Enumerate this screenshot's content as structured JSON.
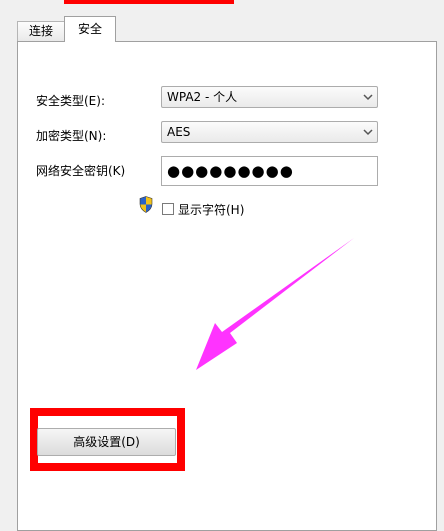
{
  "tabs": [
    {
      "label": "连接",
      "active": false
    },
    {
      "label": "安全",
      "active": true
    }
  ],
  "security_type": {
    "label": "安全类型(E):",
    "value": "WPA2 - 个人"
  },
  "encryption_type": {
    "label": "加密类型(N):",
    "value": "AES"
  },
  "network_key": {
    "label": "网络安全密钥(K)",
    "value": "●●●●●●●●●"
  },
  "show_characters": {
    "label": "显示字符(H)",
    "checked": false
  },
  "advanced_button": {
    "label": "高级设置(D)"
  },
  "colors": {
    "highlight": "#ff0000",
    "arrow": "#ff33ff"
  }
}
